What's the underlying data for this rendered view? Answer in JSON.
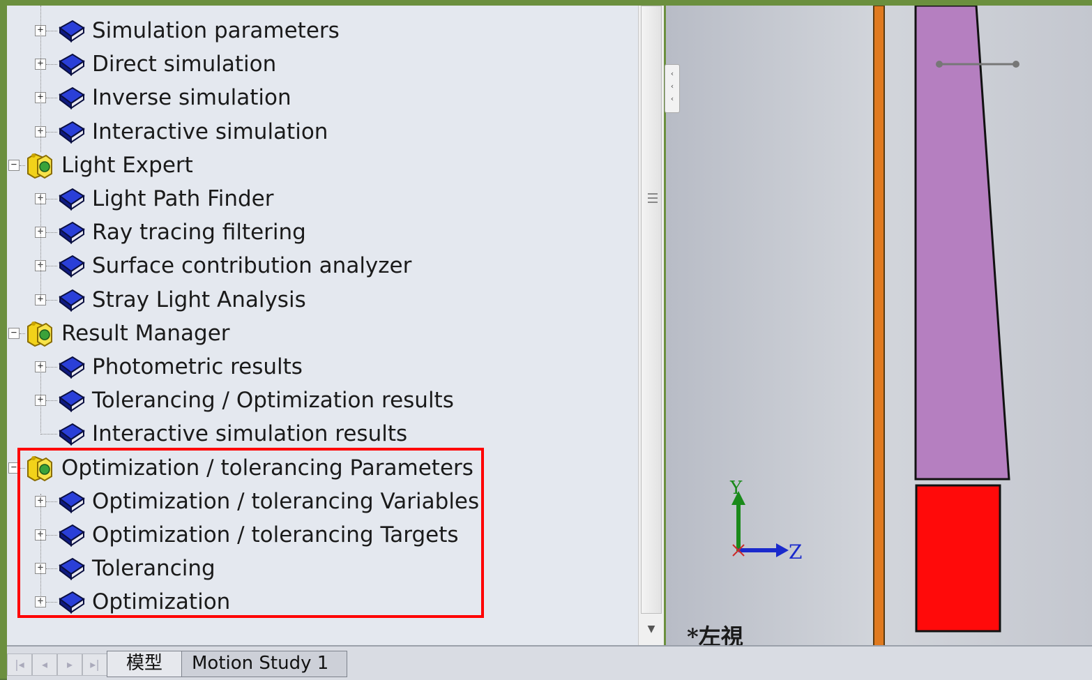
{
  "tree": {
    "rows": [
      {
        "label": "Simulation parameters",
        "kind": "book",
        "level": 1,
        "expandable": true
      },
      {
        "label": "Direct simulation",
        "kind": "book",
        "level": 1,
        "expandable": true
      },
      {
        "label": "Inverse simulation",
        "kind": "book",
        "level": 1,
        "expandable": true
      },
      {
        "label": "Interactive simulation",
        "kind": "book",
        "level": 1,
        "expandable": true
      },
      {
        "label": "Light Expert",
        "kind": "folder",
        "level": 0,
        "expandable": true
      },
      {
        "label": "Light Path Finder",
        "kind": "book",
        "level": 1,
        "expandable": true
      },
      {
        "label": "Ray tracing filtering",
        "kind": "book",
        "level": 1,
        "expandable": true
      },
      {
        "label": "Surface contribution analyzer",
        "kind": "book",
        "level": 1,
        "expandable": true
      },
      {
        "label": "Stray Light Analysis",
        "kind": "book",
        "level": 1,
        "expandable": true
      },
      {
        "label": "Result Manager",
        "kind": "folder",
        "level": 0,
        "expandable": true
      },
      {
        "label": "Photometric results",
        "kind": "book",
        "level": 1,
        "expandable": true
      },
      {
        "label": "Tolerancing / Optimization results",
        "kind": "book",
        "level": 1,
        "expandable": true
      },
      {
        "label": "Interactive simulation results",
        "kind": "book",
        "level": 1,
        "expandable": false
      },
      {
        "label": "Optimization / tolerancing Parameters",
        "kind": "folder",
        "level": 0,
        "expandable": true
      },
      {
        "label": "Optimization / tolerancing Variables",
        "kind": "book",
        "level": 1,
        "expandable": true
      },
      {
        "label": "Optimization / tolerancing Targets",
        "kind": "book",
        "level": 1,
        "expandable": true
      },
      {
        "label": "Tolerancing",
        "kind": "book",
        "level": 1,
        "expandable": true
      },
      {
        "label": "Optimization",
        "kind": "book",
        "level": 1,
        "expandable": true
      }
    ]
  },
  "viewport": {
    "view_label": "*左視",
    "axis_y": "Y",
    "axis_z": "Z"
  },
  "tabs": [
    {
      "label": "模型",
      "active": true
    },
    {
      "label": "Motion Study 1",
      "active": false
    }
  ],
  "colors": {
    "highlight": "#ff0000",
    "book_blue": "#1c2bb5",
    "orange_bar": "#e07a1f",
    "purple_part": "#b57fc0",
    "red_part": "#ff0a0a"
  }
}
